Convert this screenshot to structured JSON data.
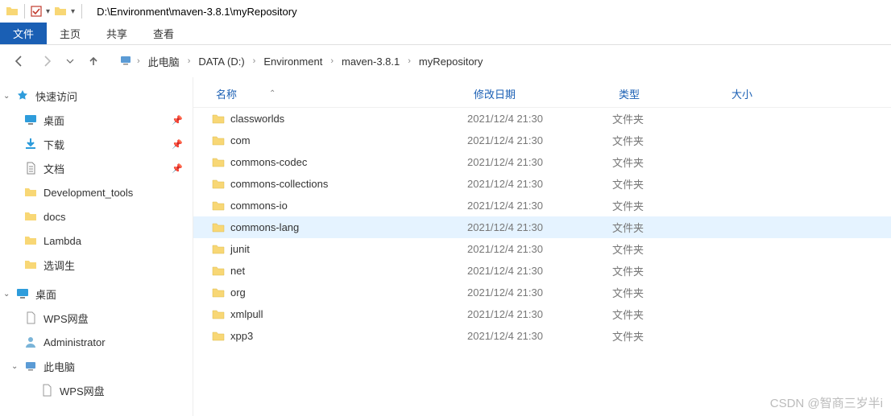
{
  "title": "D:\\Environment\\maven-3.8.1\\myRepository",
  "ribbon": {
    "file": "文件",
    "home": "主页",
    "share": "共享",
    "view": "查看"
  },
  "breadcrumbs": [
    "此电脑",
    "DATA (D:)",
    "Environment",
    "maven-3.8.1",
    "myRepository"
  ],
  "sidebar": {
    "quick": "快速访问",
    "pinned": [
      {
        "label": "桌面",
        "icon": "desktop"
      },
      {
        "label": "下载",
        "icon": "download"
      },
      {
        "label": "文档",
        "icon": "doc"
      }
    ],
    "folders": [
      "Development_tools",
      "docs",
      "Lambda",
      "选调生"
    ],
    "desktop": "桌面",
    "extra": [
      {
        "label": "WPS网盘",
        "icon": "file"
      },
      {
        "label": "Administrator",
        "icon": "user"
      },
      {
        "label": "此电脑",
        "icon": "pc"
      },
      {
        "label": "WPS网盘",
        "icon": "file",
        "indent": true
      }
    ]
  },
  "columns": {
    "name": "名称",
    "date": "修改日期",
    "type": "类型",
    "size": "大小"
  },
  "files": [
    {
      "name": "classworlds",
      "date": "2021/12/4 21:30",
      "type": "文件夹"
    },
    {
      "name": "com",
      "date": "2021/12/4 21:30",
      "type": "文件夹"
    },
    {
      "name": "commons-codec",
      "date": "2021/12/4 21:30",
      "type": "文件夹"
    },
    {
      "name": "commons-collections",
      "date": "2021/12/4 21:30",
      "type": "文件夹"
    },
    {
      "name": "commons-io",
      "date": "2021/12/4 21:30",
      "type": "文件夹"
    },
    {
      "name": "commons-lang",
      "date": "2021/12/4 21:30",
      "type": "文件夹",
      "hover": true
    },
    {
      "name": "junit",
      "date": "2021/12/4 21:30",
      "type": "文件夹"
    },
    {
      "name": "net",
      "date": "2021/12/4 21:30",
      "type": "文件夹"
    },
    {
      "name": "org",
      "date": "2021/12/4 21:30",
      "type": "文件夹"
    },
    {
      "name": "xmlpull",
      "date": "2021/12/4 21:30",
      "type": "文件夹"
    },
    {
      "name": "xpp3",
      "date": "2021/12/4 21:30",
      "type": "文件夹"
    }
  ],
  "watermark": "CSDN @智商三岁半i"
}
